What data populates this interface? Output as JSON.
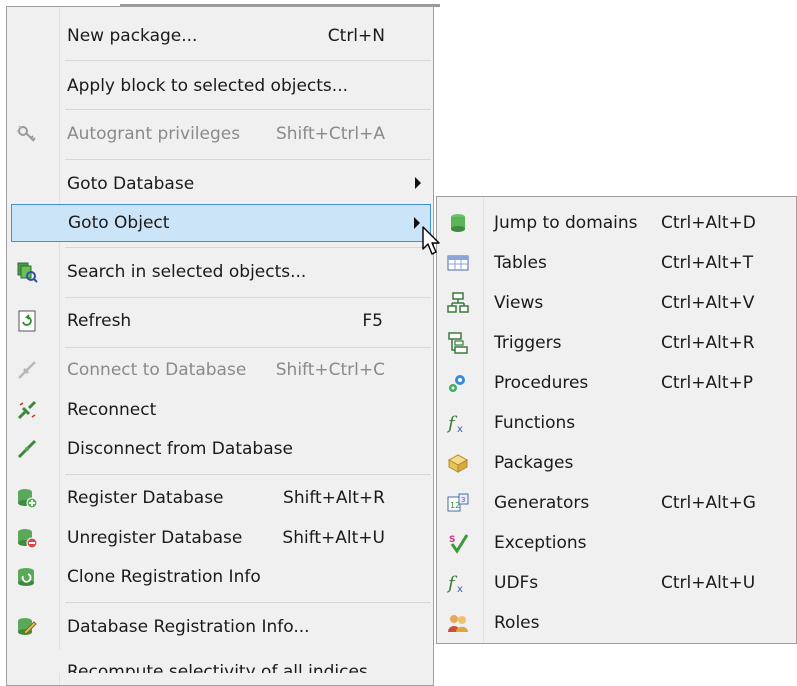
{
  "menu": {
    "items": [
      {
        "label": "New package...",
        "shortcut": "Ctrl+N"
      },
      {
        "label": "Apply block to selected objects...",
        "shortcut": ""
      },
      {
        "label": "Autogrant privileges",
        "shortcut": "Shift+Ctrl+A",
        "disabled": true,
        "icon": "key-icon"
      },
      {
        "label": "Goto Database",
        "shortcut": "",
        "submenu": true
      },
      {
        "label": "Goto Object",
        "shortcut": "",
        "submenu": true,
        "highlighted": true
      },
      {
        "label": "Search in selected objects...",
        "shortcut": "",
        "icon": "search-objects-icon"
      },
      {
        "label": "Refresh",
        "shortcut": "F5",
        "icon": "refresh-icon"
      },
      {
        "label": "Connect to Database",
        "shortcut": "Shift+Ctrl+C",
        "disabled": true,
        "icon": "connect-icon"
      },
      {
        "label": "Reconnect",
        "shortcut": "",
        "icon": "reconnect-icon"
      },
      {
        "label": "Disconnect from Database",
        "shortcut": "",
        "icon": "disconnect-icon"
      },
      {
        "label": "Register Database",
        "shortcut": "Shift+Alt+R",
        "icon": "register-db-icon"
      },
      {
        "label": "Unregister Database",
        "shortcut": "Shift+Alt+U",
        "icon": "unregister-db-icon"
      },
      {
        "label": "Clone Registration Info",
        "shortcut": "",
        "icon": "clone-db-icon"
      },
      {
        "label": "Database Registration Info...",
        "shortcut": "",
        "icon": "db-info-icon"
      },
      {
        "label": "Recompute selectivity of all indices",
        "shortcut": ""
      }
    ]
  },
  "submenu": {
    "items": [
      {
        "label": "Jump to domains",
        "shortcut": "Ctrl+Alt+D",
        "icon": "domains-icon"
      },
      {
        "label": "Tables",
        "shortcut": "Ctrl+Alt+T",
        "icon": "tables-icon"
      },
      {
        "label": "Views",
        "shortcut": "Ctrl+Alt+V",
        "icon": "views-icon"
      },
      {
        "label": "Triggers",
        "shortcut": "Ctrl+Alt+R",
        "icon": "triggers-icon"
      },
      {
        "label": "Procedures",
        "shortcut": "Ctrl+Alt+P",
        "icon": "procedures-icon"
      },
      {
        "label": "Functions",
        "shortcut": "",
        "icon": "functions-icon"
      },
      {
        "label": "Packages",
        "shortcut": "",
        "icon": "packages-icon"
      },
      {
        "label": "Generators",
        "shortcut": "Ctrl+Alt+G",
        "icon": "generators-icon"
      },
      {
        "label": "Exceptions",
        "shortcut": "",
        "icon": "exceptions-icon"
      },
      {
        "label": "UDFs",
        "shortcut": "Ctrl+Alt+U",
        "icon": "udfs-icon"
      },
      {
        "label": "Roles",
        "shortcut": "",
        "icon": "roles-icon"
      }
    ]
  },
  "colors": {
    "menu_bg": "#f0f0f0",
    "highlight_bg": "#cce4f7",
    "highlight_border": "#3f8fd9",
    "disabled_text": "#8a8a8a"
  }
}
